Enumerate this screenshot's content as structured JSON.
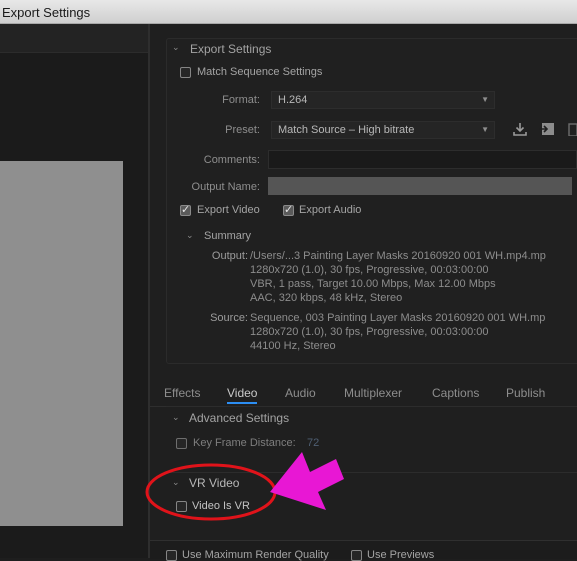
{
  "window": {
    "title": "Export Settings"
  },
  "export_settings": {
    "section_title": "Export Settings",
    "match_sequence_label": "Match Sequence Settings",
    "format_label": "Format:",
    "format_value": "H.264",
    "preset_label": "Preset:",
    "preset_value": "Match Source – High bitrate",
    "comments_label": "Comments:",
    "output_name_label": "Output Name:",
    "export_video_label": "Export Video",
    "export_audio_label": "Export Audio"
  },
  "summary": {
    "title": "Summary",
    "output_label": "Output:",
    "output_lines": [
      "/Users/...3 Painting Layer Masks 20160920 001 WH.mp4.mp",
      "1280x720 (1.0), 30 fps, Progressive, 00:03:00:00",
      "VBR, 1 pass, Target 10.00 Mbps, Max 12.00 Mbps",
      "AAC, 320 kbps, 48 kHz, Stereo"
    ],
    "source_label": "Source:",
    "source_lines": [
      "Sequence, 003 Painting Layer Masks 20160920 001 WH.mp",
      "1280x720 (1.0), 30 fps, Progressive, 00:03:00:00",
      "44100 Hz, Stereo"
    ]
  },
  "tabs": [
    "Effects",
    "Video",
    "Audio",
    "Multiplexer",
    "Captions",
    "Publish"
  ],
  "video_tab": {
    "advanced_title": "Advanced Settings",
    "key_frame_label": "Key Frame Distance:",
    "key_frame_value": "72",
    "vr_title": "VR Video",
    "vr_checkbox_label": "Video Is VR"
  },
  "bottom": {
    "max_render_label": "Use Maximum Render Quality",
    "use_previews_label": "Use Previews"
  },
  "colors": {
    "highlight_ellipse": "#e0131a",
    "annotation_arrow": "#e817d4",
    "tab_underline": "#2c8ef3"
  },
  "icons": [
    "chevron-down-icon",
    "download-preset-icon",
    "import-preset-icon",
    "delete-preset-icon",
    "checkmark-icon",
    "arrow-annotation-icon"
  ]
}
